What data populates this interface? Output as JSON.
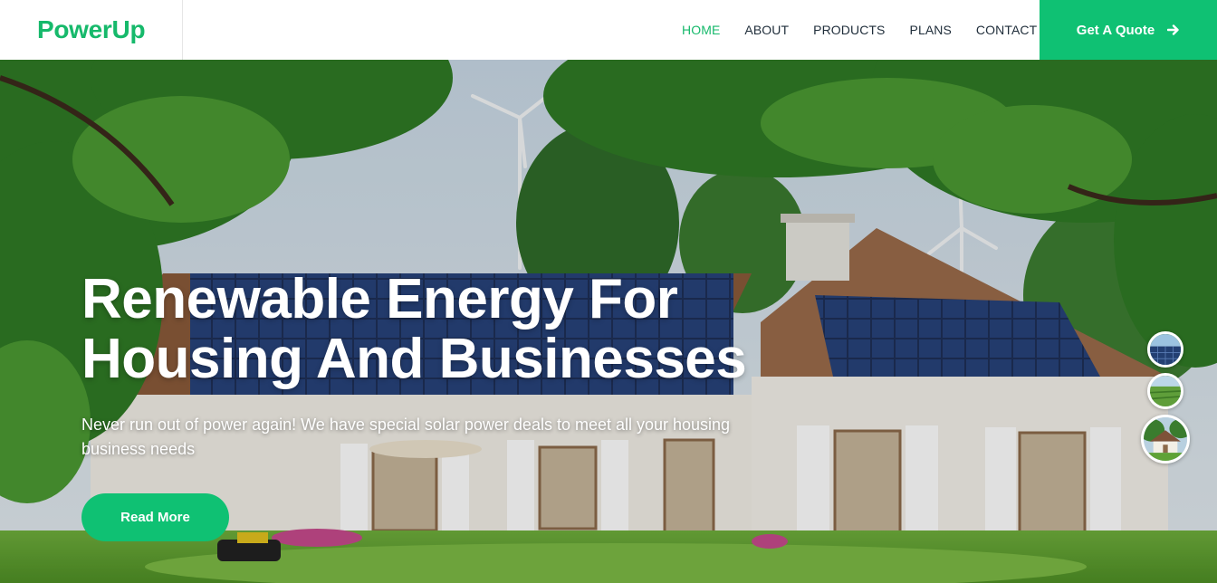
{
  "brand": {
    "name": "PowerUp"
  },
  "nav": {
    "items": [
      {
        "label": "HOME",
        "active": true
      },
      {
        "label": "ABOUT",
        "active": false
      },
      {
        "label": "PRODUCTS",
        "active": false
      },
      {
        "label": "PLANS",
        "active": false
      },
      {
        "label": "CONTACT",
        "active": false
      }
    ],
    "cta_label": "Get A Quote",
    "cta_icon": "arrow-right-icon"
  },
  "hero": {
    "title_line1": "Renewable Energy For",
    "title_line2": "Housing And Businesses",
    "subtitle": "Never run out of power again! We have special solar power deals to meet all your housing business needs",
    "button_label": "Read More"
  },
  "carousel": {
    "thumbnails": [
      "solar-panels-thumbnail",
      "green-field-thumbnail",
      "house-thumbnail"
    ],
    "active_index": 2
  },
  "colors": {
    "accent": "#0fc173",
    "brand": "#16b96b",
    "nav_text": "#1f2d3a"
  }
}
